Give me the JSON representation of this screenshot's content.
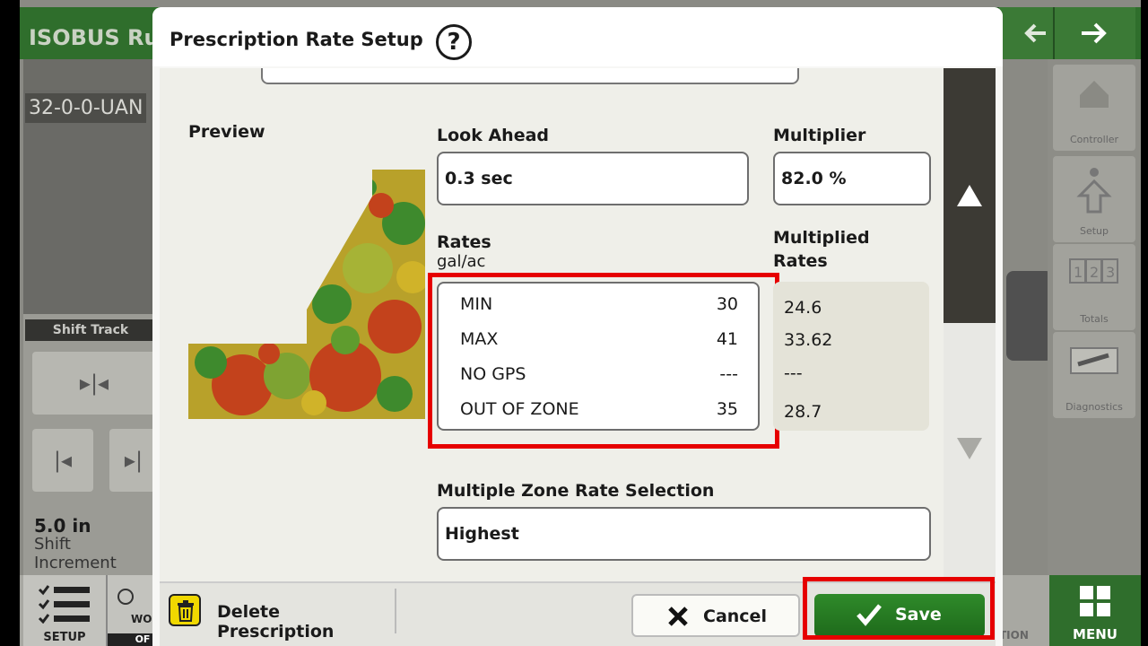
{
  "app": {
    "title": "ISOBUS Ru",
    "product_label": "32-0-0-UAN",
    "shift_track_label": "Shift Track",
    "shift_increment_value": "5.0 in",
    "shift_increment_label": "Shift Increment",
    "rail": {
      "controller_label": "Controller",
      "setup_label": "Setup",
      "totals_label": "Totals",
      "diagnostics_label": "Diagnostics"
    },
    "bottom": {
      "setup_label": "SETUP",
      "work_label": "WO",
      "work_state": "OF",
      "section_label": "TION",
      "menu_label": "MENU"
    }
  },
  "dialog": {
    "title": "Prescription Rate Setup",
    "help_glyph": "?",
    "preview_label": "Preview",
    "look_ahead": {
      "label": "Look Ahead",
      "value": "0.3 sec"
    },
    "multiplier": {
      "label": "Multiplier",
      "value": "82.0 %"
    },
    "rates": {
      "label": "Rates",
      "units": "gal/ac",
      "rows": [
        {
          "name": "MIN",
          "value": "30"
        },
        {
          "name": "MAX",
          "value": "41"
        },
        {
          "name": "NO GPS",
          "value": "---"
        },
        {
          "name": "OUT OF ZONE",
          "value": "35"
        }
      ]
    },
    "multiplied_rates": {
      "label_line1": "Multiplied",
      "label_line2": "Rates",
      "values": [
        "24.6",
        "33.62",
        "---",
        "28.7"
      ]
    },
    "zone_selection": {
      "label": "Multiple Zone Rate Selection",
      "value": "Highest"
    },
    "footer": {
      "delete_label": "Delete Prescription",
      "cancel_label": "Cancel",
      "save_label": "Save"
    }
  },
  "colors": {
    "jd_green": "#2f6e2c",
    "save_green": "#2f8a2a",
    "highlight_red": "#e60000",
    "trash_yellow": "#f0d800"
  }
}
